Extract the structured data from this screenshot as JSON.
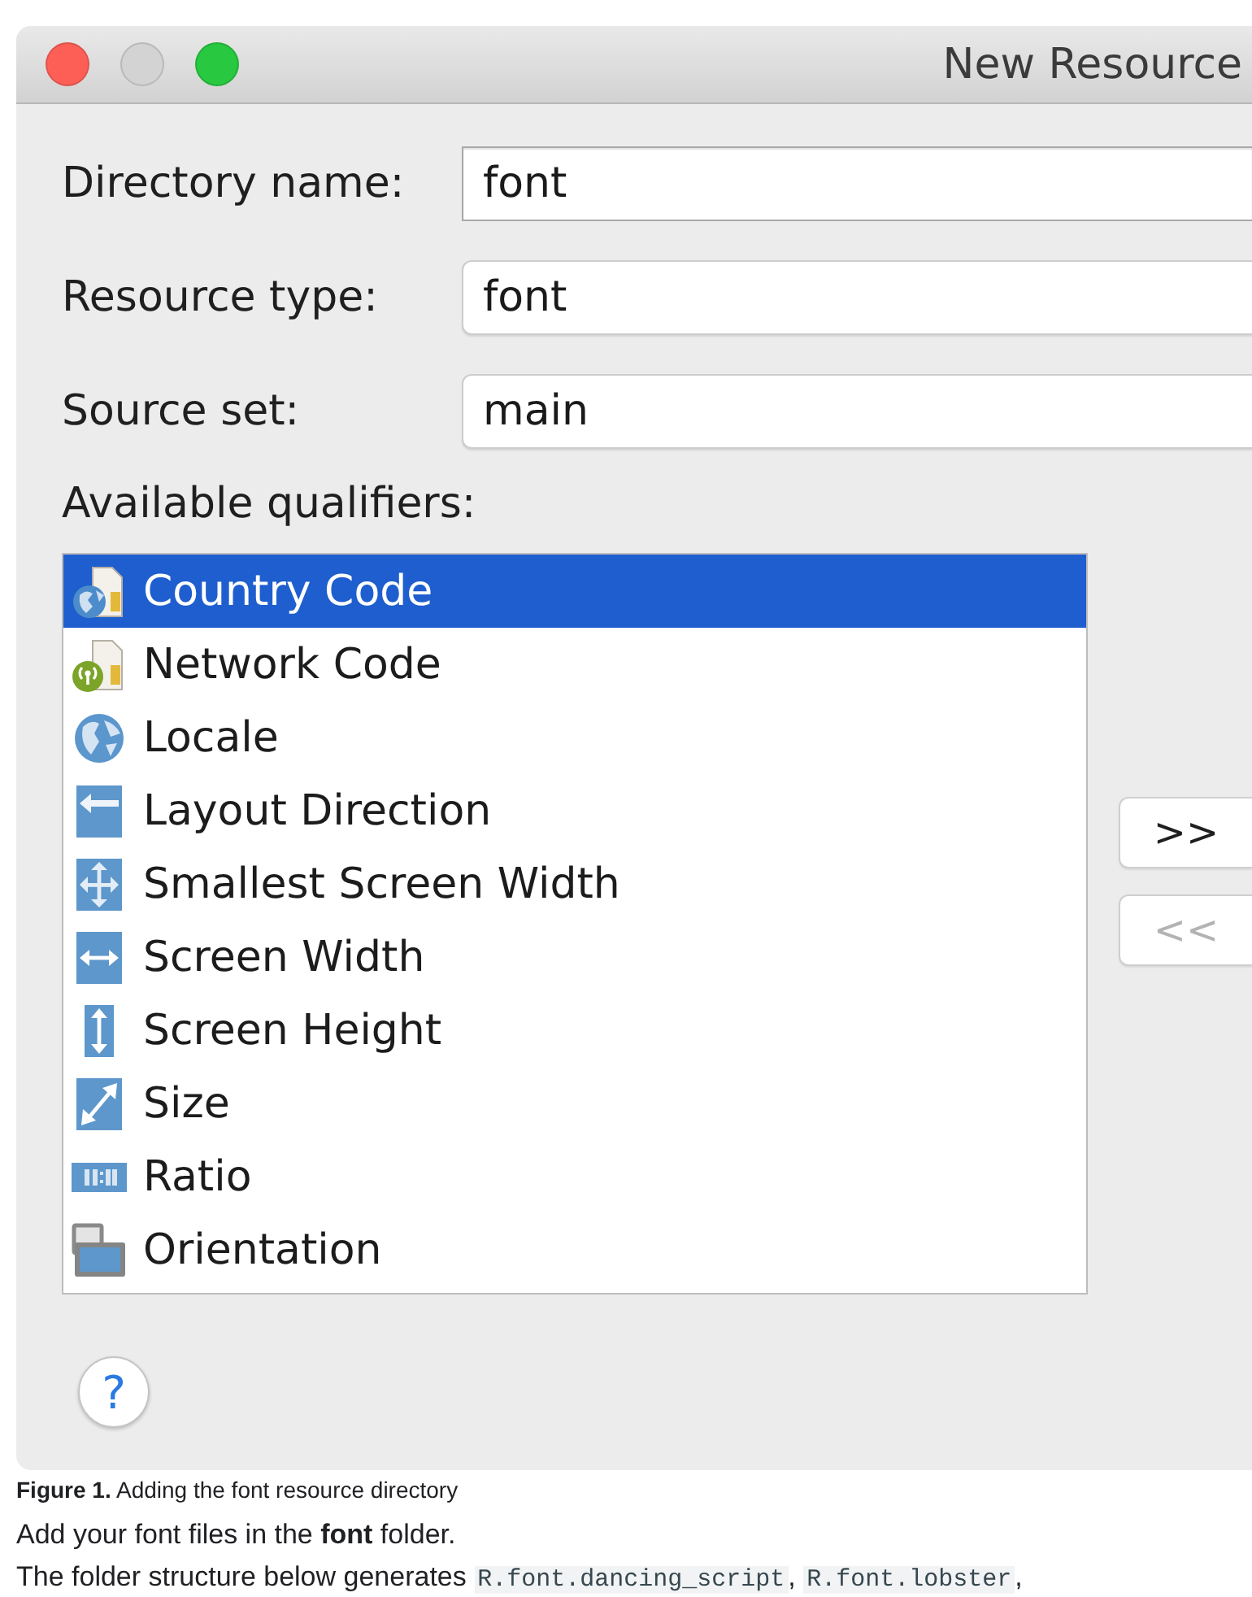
{
  "window": {
    "title": "New Resource",
    "controls": [
      {
        "kind": "close",
        "disabled": false
      },
      {
        "kind": "minimize",
        "disabled": true
      },
      {
        "kind": "zoom",
        "disabled": false
      }
    ]
  },
  "form": {
    "fields": [
      {
        "label": "Directory name:",
        "value": "font",
        "kind": "text"
      },
      {
        "label": "Resource type:",
        "value": "font",
        "kind": "combo"
      },
      {
        "label": "Source set:",
        "value": "main",
        "kind": "combo"
      }
    ]
  },
  "qualifiers": {
    "label": "Available qualifiers:",
    "items": [
      {
        "name": "Country Code",
        "selected": true
      },
      {
        "name": "Network Code",
        "selected": false
      },
      {
        "name": "Locale",
        "selected": false
      },
      {
        "name": "Layout Direction",
        "selected": false
      },
      {
        "name": "Smallest Screen Width",
        "selected": false
      },
      {
        "name": "Screen Width",
        "selected": false
      },
      {
        "name": "Screen Height",
        "selected": false
      },
      {
        "name": "Size",
        "selected": false
      },
      {
        "name": "Ratio",
        "selected": false
      },
      {
        "name": "Orientation",
        "selected": false
      }
    ]
  },
  "move_buttons": [
    {
      "label": ">>",
      "disabled": false
    },
    {
      "label": "<<",
      "disabled": true
    }
  ],
  "help_button": {
    "label": "?"
  },
  "caption": "**Figure 1.** Adding the font resource directory",
  "paragraphs": [
    {
      "segments": [
        {
          "kind": "text",
          "text": "Add your font files in the **font** folder."
        }
      ]
    },
    {
      "segments": [
        {
          "kind": "text",
          "text": "The folder structure below generates "
        },
        {
          "kind": "code",
          "text": "R.font.dancing_script"
        },
        {
          "kind": "text",
          "text": ", "
        },
        {
          "kind": "code",
          "text": "R.font.lobster"
        },
        {
          "kind": "text",
          "text": ","
        }
      ]
    }
  ]
}
